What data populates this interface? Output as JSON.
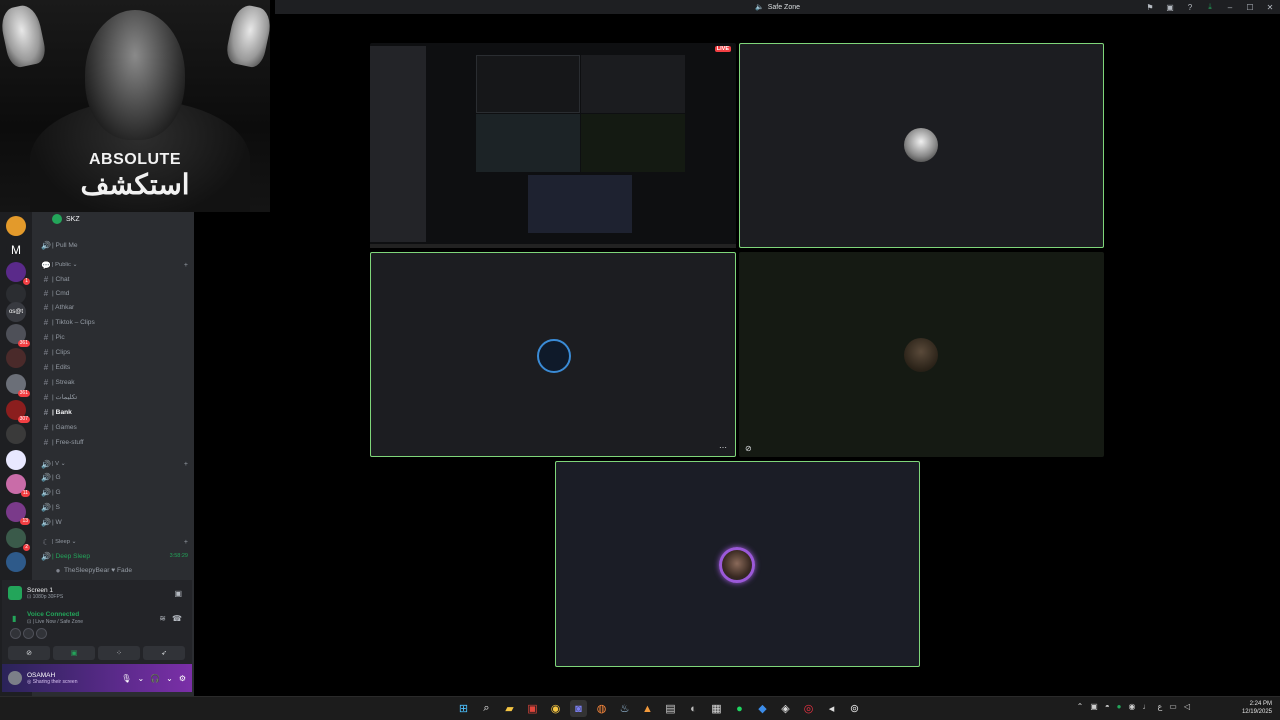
{
  "window": {
    "title": "Safe Zone"
  },
  "webcam": {
    "overlay_en": "ABSOLUTE",
    "overlay_ar": "استكشف"
  },
  "server_rail": {
    "badges": [
      "1",
      "361",
      "361",
      "307",
      "11",
      "13",
      "2"
    ]
  },
  "channels": {
    "header": "SKZ",
    "items": [
      {
        "icon": "speaker-icon",
        "label": "| Pull Me",
        "kind": "voice"
      },
      {
        "icon": "chat-bubble-icon",
        "label": "| Public ⌄",
        "kind": "category"
      },
      {
        "icon": "hash-icon",
        "label": "| Chat",
        "kind": "text"
      },
      {
        "icon": "hash-icon",
        "label": "| Cmd",
        "kind": "text"
      },
      {
        "icon": "hash-icon",
        "label": "| Athkar",
        "kind": "text"
      },
      {
        "icon": "hash-icon",
        "label": "| Tiktok – Clips",
        "kind": "text"
      },
      {
        "icon": "hash-icon",
        "label": "| Pic",
        "kind": "text"
      },
      {
        "icon": "hash-icon",
        "label": "| Clips",
        "kind": "text"
      },
      {
        "icon": "hash-icon",
        "label": "| Edits",
        "kind": "text"
      },
      {
        "icon": "hash-icon",
        "label": "| Streak",
        "kind": "text"
      },
      {
        "icon": "hash-icon",
        "label": "| تكليمات",
        "kind": "text"
      },
      {
        "icon": "hash-icon",
        "label": "| Bank",
        "kind": "text",
        "active": true
      },
      {
        "icon": "hash-icon",
        "label": "| Games",
        "kind": "text"
      },
      {
        "icon": "hash-icon",
        "label": "| Free-stuff",
        "kind": "text"
      },
      {
        "icon": "speaker-icon",
        "label": "| V ⌄",
        "kind": "category"
      },
      {
        "icon": "speaker-icon",
        "label": "| G",
        "kind": "voice"
      },
      {
        "icon": "speaker-icon",
        "label": "| G",
        "kind": "voice"
      },
      {
        "icon": "speaker-icon",
        "label": "| S",
        "kind": "voice"
      },
      {
        "icon": "speaker-icon",
        "label": "| W",
        "kind": "voice"
      },
      {
        "icon": "moon-icon",
        "label": "| Sleep ⌄",
        "kind": "category"
      },
      {
        "icon": "speaker-icon",
        "label": "| Deep Sleep",
        "kind": "voice",
        "green": true,
        "time": "3:58:29"
      },
      {
        "icon": "avatar-icon",
        "label": "TheSleepyBear  ♥ Fade",
        "kind": "member"
      }
    ]
  },
  "screen_panel": {
    "title": "Screen 1",
    "subtitle": "⊡ 1080p 30FPS"
  },
  "voice_panel": {
    "status": "Voice Connected",
    "location": "⊡ | Live Now / Safe Zone"
  },
  "user": {
    "name": "OSAMAH",
    "status": "◎ Sharing their screen"
  },
  "stage": {
    "live_label": "LIVE",
    "more": "⋯"
  },
  "colors": {
    "accent_green": "#23a55a",
    "tile_border": "#7fd67a",
    "live_red": "#f23f43",
    "purple": "#7b2fa8"
  },
  "clock": {
    "time": "2:24 PM",
    "date": "12/19/2025"
  }
}
